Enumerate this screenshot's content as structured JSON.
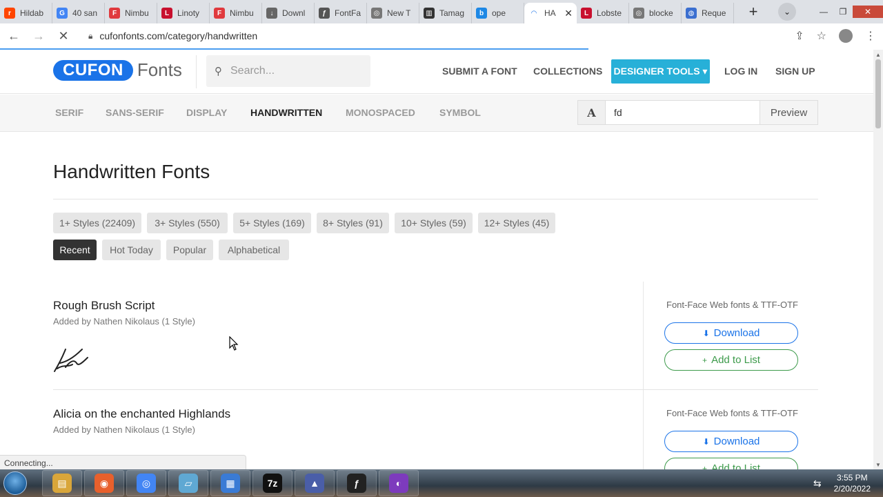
{
  "browser": {
    "tabs": [
      {
        "label": "Hildab",
        "fav_color": "#ff4500",
        "fav_char": "r"
      },
      {
        "label": "40 san",
        "fav_color": "#4285f4",
        "fav_char": "G"
      },
      {
        "label": "Nimbu",
        "fav_color": "#e03a3e",
        "fav_char": "F"
      },
      {
        "label": "Linoty",
        "fav_color": "#c8102e",
        "fav_char": "L"
      },
      {
        "label": "Nimbu",
        "fav_color": "#e03a3e",
        "fav_char": "F"
      },
      {
        "label": "Downl",
        "fav_color": "#666666",
        "fav_char": "↓"
      },
      {
        "label": "FontFa",
        "fav_color": "#555555",
        "fav_char": "ƒ"
      },
      {
        "label": "New T",
        "fav_color": "#777777",
        "fav_char": "◎"
      },
      {
        "label": "Tamag",
        "fav_color": "#333333",
        "fav_char": "▥"
      },
      {
        "label": "ope",
        "fav_color": "#1e88e5",
        "fav_char": "b"
      },
      {
        "label": "HA",
        "fav_color": "#ffffff",
        "fav_char": "◠",
        "active": true
      },
      {
        "label": "Lobste",
        "fav_color": "#c8102e",
        "fav_char": "L"
      },
      {
        "label": "blocke",
        "fav_color": "#777777",
        "fav_char": "◎"
      },
      {
        "label": "Reque",
        "fav_color": "#3b6fd0",
        "fav_char": "◍"
      }
    ],
    "new_tab": "+",
    "url": "cufonfonts.com/category/handwritten",
    "status": "Connecting..."
  },
  "site": {
    "logo_pill": "CUFON",
    "logo_word": "Fonts",
    "search_placeholder": "Search...",
    "nav": {
      "submit": "SUBMIT A FONT",
      "collections": "COLLECTIONS",
      "designer": "DESIGNER TOOLS ▾",
      "login": "LOG IN",
      "signup": "SIGN UP"
    },
    "categories": [
      "SERIF",
      "SANS-SERIF",
      "DISPLAY",
      "HANDWRITTEN",
      "MONOSPACED",
      "SYMBOL"
    ],
    "active_category": "HANDWRITTEN",
    "preview": {
      "icon_letter": "A",
      "value": "fd",
      "button": "Preview"
    }
  },
  "main": {
    "title": "Handwritten Fonts",
    "style_filters": [
      "1+ Styles (22409)",
      "3+ Styles (550)",
      "5+ Styles (169)",
      "8+ Styles (91)",
      "10+ Styles (59)",
      "12+ Styles (45)"
    ],
    "sort_options": [
      "Recent",
      "Hot Today",
      "Popular",
      "Alphabetical"
    ],
    "active_sort": "Recent",
    "fonts": [
      {
        "name": "Rough Brush Script",
        "meta": "Added by Nathen Nikolaus (1 Style)",
        "format": "Font-Face Web fonts & TTF-OTF",
        "download": "Download",
        "add": "Add to List"
      },
      {
        "name": "Alicia on the enchanted Highlands",
        "meta": "Added by Nathen Nikolaus (1 Style)",
        "format": "Font-Face Web fonts & TTF-OTF",
        "download": "Download",
        "add": "Add to List"
      }
    ]
  },
  "taskbar": {
    "apps": [
      {
        "name": "explorer",
        "color": "#d9a63a",
        "char": "▤"
      },
      {
        "name": "firefox",
        "color": "#e8602c",
        "char": "◉"
      },
      {
        "name": "chrome",
        "color": "#4285f4",
        "char": "◎"
      },
      {
        "name": "notepad",
        "color": "#5fa8d3",
        "char": "▱"
      },
      {
        "name": "control-panel",
        "color": "#3a7bd5",
        "char": "▦"
      },
      {
        "name": "7zip",
        "color": "#111111",
        "char": "7z"
      },
      {
        "name": "inkscape",
        "color": "#4a5ea8",
        "char": "▲"
      },
      {
        "name": "fontforge",
        "color": "#222222",
        "char": "ƒ"
      },
      {
        "name": "tor",
        "color": "#7d3bbd",
        "char": "◐"
      }
    ],
    "time": "3:55 PM",
    "date": "2/20/2022"
  }
}
